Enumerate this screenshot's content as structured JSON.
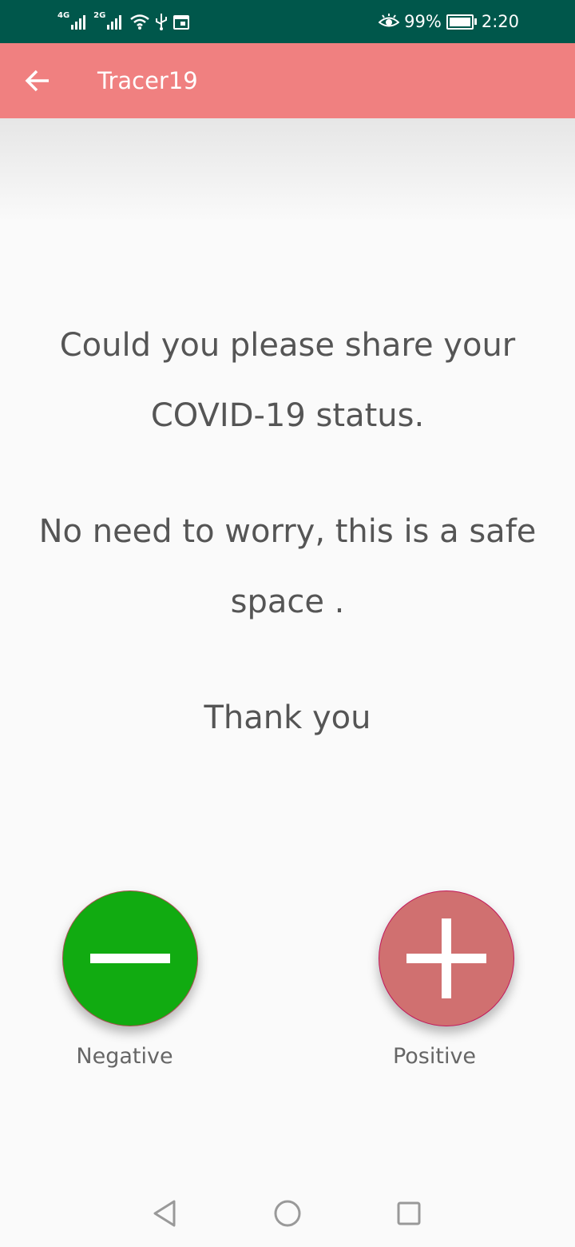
{
  "status_bar": {
    "network_1": "4G",
    "network_2": "2G",
    "battery_percent": "99%",
    "battery_level": 0.99,
    "time": "2:20",
    "icons": [
      "signal-icon",
      "signal-icon",
      "wifi-icon",
      "usb-icon",
      "calendar-icon",
      "eye-icon",
      "battery-icon"
    ]
  },
  "app_bar": {
    "title": "Tracer19",
    "back_icon": "back-arrow-icon",
    "background": "#f08080"
  },
  "message": {
    "line1": "Could you please share your COVID-19 status.",
    "line2": "No need to worry, this is a safe space .",
    "line3": "Thank you"
  },
  "actions": {
    "negative": {
      "label": "Negative",
      "icon": "minus-icon",
      "color": "#11ab11"
    },
    "positive": {
      "label": "Positive",
      "icon": "plus-icon",
      "color": "#d07070"
    }
  },
  "nav_bar": {
    "icons": [
      "back-triangle-icon",
      "home-circle-icon",
      "recents-square-icon"
    ]
  }
}
